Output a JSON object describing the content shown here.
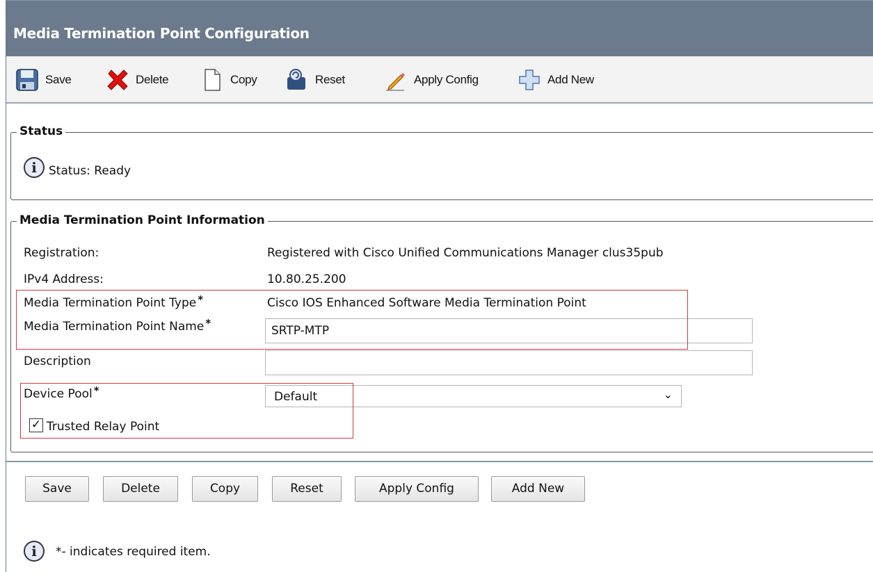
{
  "window": {
    "title": "Media Termination Point Configuration"
  },
  "toolbar": {
    "save_label": "Save",
    "delete_label": "Delete",
    "copy_label": "Copy",
    "reset_label": "Reset",
    "apply_config_label": "Apply Config",
    "add_new_label": "Add New"
  },
  "status": {
    "legend": "Status",
    "text": "Status: Ready"
  },
  "info": {
    "legend": "Media Termination Point Information",
    "registration_label": "Registration:",
    "registration_value": "Registered with Cisco Unified Communications Manager clus35pub",
    "ipv4_label": "IPv4 Address:",
    "ipv4_value": "10.80.25.200",
    "type_label": "Media Termination Point Type",
    "type_value": "Cisco IOS Enhanced Software Media Termination Point",
    "name_label": "Media Termination Point Name",
    "name_value": "SRTP-MTP",
    "description_label": "Description",
    "description_value": "",
    "device_pool_label": "Device Pool",
    "device_pool_value": "Default",
    "trusted_relay_label": "Trusted Relay Point",
    "trusted_relay_checked": true,
    "required_marker": "*"
  },
  "buttons": {
    "save": "Save",
    "delete": "Delete",
    "copy": "Copy",
    "reset": "Reset",
    "apply_config": "Apply Config",
    "add_new": "Add New"
  },
  "footer": {
    "note": "*- indicates required item."
  },
  "colors": {
    "title_bar": "#6c7a8d",
    "highlight": "#d9363e"
  }
}
